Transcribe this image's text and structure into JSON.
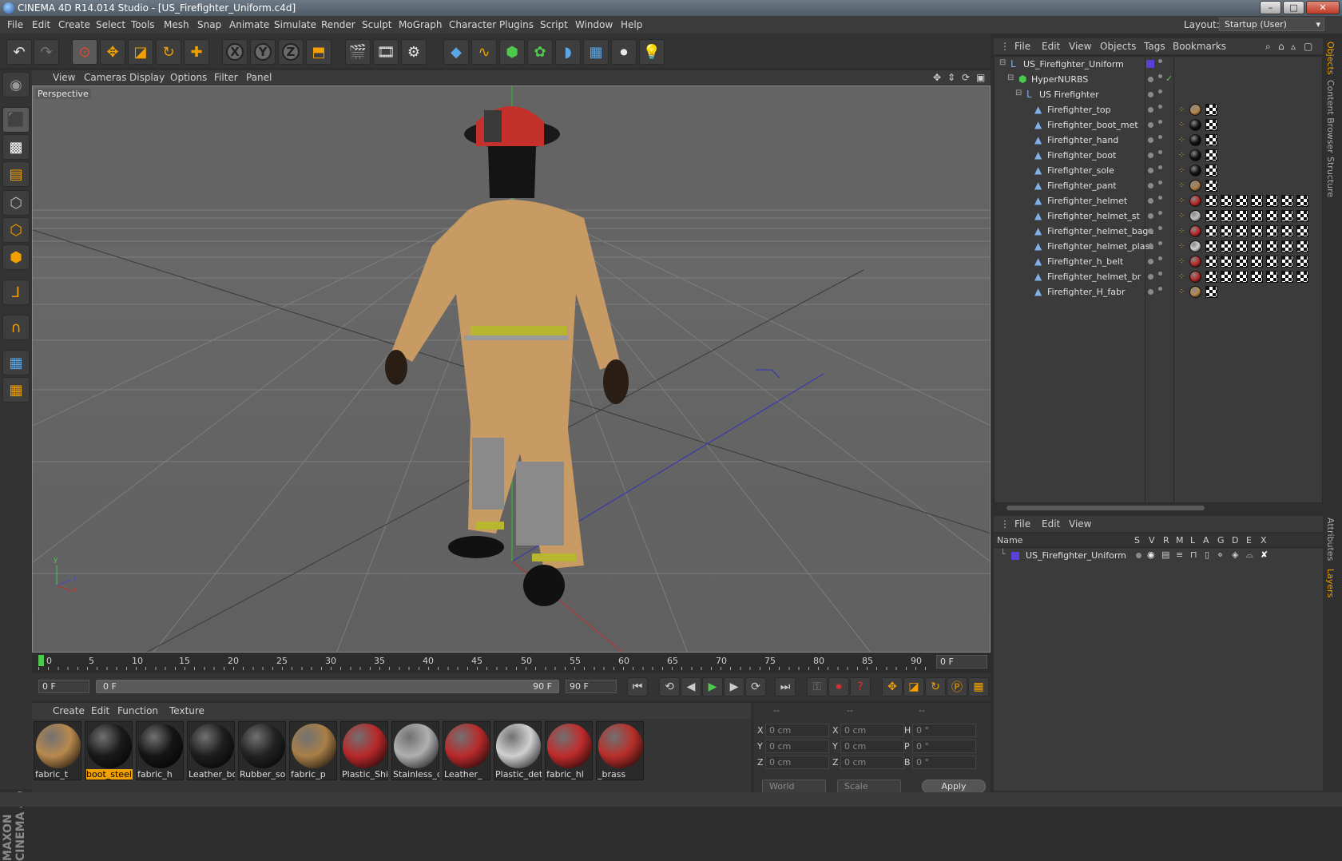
{
  "window": {
    "title": "CINEMA 4D R14.014 Studio - [US_Firefighter_Uniform.c4d]",
    "minimize": "–",
    "maximize": "□",
    "close": "✕"
  },
  "menu": [
    "File",
    "Edit",
    "Create",
    "Select",
    "Tools",
    "Mesh",
    "Snap",
    "Animate",
    "Simulate",
    "Render",
    "Sculpt",
    "MoGraph",
    "Character",
    "Plugins",
    "Script",
    "Window",
    "Help"
  ],
  "layout": {
    "label": "Layout:",
    "value": "Startup (User)"
  },
  "viewport": {
    "menu": [
      "View",
      "Cameras",
      "Display",
      "Options",
      "Filter",
      "Panel"
    ],
    "label": "Perspective"
  },
  "timeline": {
    "ticks": [
      "0",
      "5",
      "10",
      "15",
      "20",
      "25",
      "30",
      "35",
      "40",
      "45",
      "50",
      "55",
      "60",
      "65",
      "70",
      "75",
      "80",
      "85",
      "90"
    ],
    "current_frame": "0 F",
    "start_field": "0 F",
    "range_left": "0 F",
    "range_right": "90 F",
    "end_field": "90 F"
  },
  "materials": {
    "menu": [
      "Create",
      "Edit",
      "Function",
      "Texture"
    ],
    "items": [
      {
        "label": "fabric_t",
        "color": "#b8894d",
        "selected": false
      },
      {
        "label": "boot_steel",
        "color": "#1a1a1a",
        "selected": true
      },
      {
        "label": "fabric_h",
        "color": "#151515",
        "selected": false
      },
      {
        "label": "Leather_bo",
        "color": "#1d1d1d",
        "selected": false
      },
      {
        "label": "Rubber_so",
        "color": "#222222",
        "selected": false
      },
      {
        "label": "fabric_p",
        "color": "#a97f47",
        "selected": false
      },
      {
        "label": "Plastic_Shir",
        "color": "#b8292a",
        "selected": false
      },
      {
        "label": "Stainless_d",
        "color": "#b0b0b0",
        "selected": false
      },
      {
        "label": "Leather_",
        "color": "#b82b2b",
        "selected": false
      },
      {
        "label": "Plastic_deta",
        "color": "#d0d0d0",
        "selected": false
      },
      {
        "label": "fabric_hl",
        "color": "#c02c2c",
        "selected": false
      },
      {
        "label": "_brass",
        "color": "#b8302a",
        "selected": false
      }
    ]
  },
  "coords": {
    "header": [
      "--",
      "--",
      "--"
    ],
    "rows": [
      {
        "a": "X",
        "av": "0 cm",
        "b": "X",
        "bv": "0 cm",
        "c": "H",
        "cv": "0 °"
      },
      {
        "a": "Y",
        "av": "0 cm",
        "b": "Y",
        "bv": "0 cm",
        "c": "P",
        "cv": "0 °"
      },
      {
        "a": "Z",
        "av": "0 cm",
        "b": "Z",
        "bv": "0 cm",
        "c": "B",
        "cv": "0 °"
      }
    ],
    "mode": "World",
    "type": "Scale",
    "apply": "Apply"
  },
  "object_manager": {
    "menu": [
      "File",
      "Edit",
      "View",
      "Objects",
      "Tags",
      "Bookmarks"
    ],
    "objects": [
      {
        "name": "US_Firefighter_Uniform",
        "indent": 0
      },
      {
        "name": "HyperNURBS",
        "indent": 1
      },
      {
        "name": "US Firefighter",
        "indent": 2
      },
      {
        "name": "Firefighter_top",
        "indent": 3,
        "tags": 1,
        "ball": "#b8894d"
      },
      {
        "name": "Firefighter_boot_met",
        "indent": 3,
        "tags": 1,
        "ball": "#111"
      },
      {
        "name": "Firefighter_hand",
        "indent": 3,
        "tags": 1,
        "ball": "#111"
      },
      {
        "name": "Firefighter_boot",
        "indent": 3,
        "tags": 1,
        "ball": "#111"
      },
      {
        "name": "Firefighter_sole",
        "indent": 3,
        "tags": 1,
        "ball": "#111"
      },
      {
        "name": "Firefighter_pant",
        "indent": 3,
        "tags": 1,
        "ball": "#a97f47"
      },
      {
        "name": "Firefighter_helmet",
        "indent": 3,
        "tags": 7,
        "ball": "#b82b2b"
      },
      {
        "name": "Firefighter_helmet_st",
        "indent": 3,
        "tags": 7,
        "ball": "#c0c0c0"
      },
      {
        "name": "Firefighter_helmet_bage",
        "indent": 3,
        "tags": 7,
        "ball": "#b82b2b"
      },
      {
        "name": "Firefighter_helmet_plast",
        "indent": 3,
        "tags": 7,
        "ball": "#d0d0d0"
      },
      {
        "name": "Firefighter_h_belt",
        "indent": 3,
        "tags": 7,
        "ball": "#b82b2b"
      },
      {
        "name": "Firefighter_helmet_br",
        "indent": 3,
        "tags": 7,
        "ball": "#b82b2b"
      },
      {
        "name": "Firefighter_H_fabr",
        "indent": 3,
        "tags": 1,
        "ball": "#b8894d"
      }
    ]
  },
  "layer_manager": {
    "menu": [
      "File",
      "Edit",
      "View"
    ],
    "columns": [
      "Name",
      "S",
      "V",
      "R",
      "M",
      "L",
      "A",
      "G",
      "D",
      "E",
      "X"
    ],
    "layers": [
      {
        "name": "US_Firefighter_Uniform",
        "color": "#5b3fd6"
      }
    ]
  },
  "right_tabs": [
    "Objects",
    "Content Browser",
    "Structure",
    "Attributes",
    "Layers"
  ],
  "axis_labels": {
    "x": "x",
    "y": "y",
    "z": "z"
  },
  "logo": "MAXON CINEMA 4D"
}
